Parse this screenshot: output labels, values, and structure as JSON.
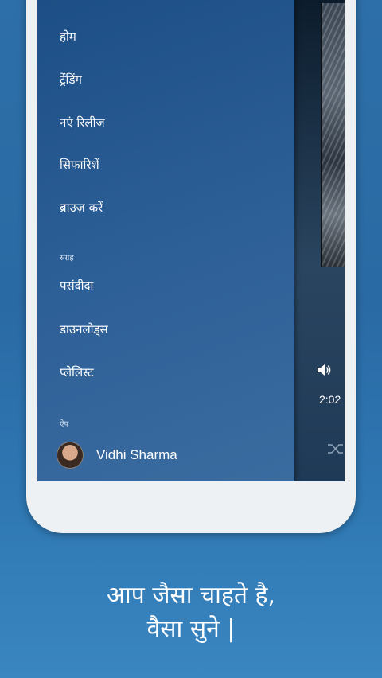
{
  "drawer": {
    "items": [
      {
        "label": "होम"
      },
      {
        "label": "ट्रेंडिंग"
      },
      {
        "label": "नएं रिलीज"
      },
      {
        "label": "सिफारिशें"
      },
      {
        "label": "ब्राउज़ करें"
      }
    ],
    "collection_label": "संग्रह",
    "collection_items": [
      {
        "label": "पसंदीदा"
      },
      {
        "label": "डाउनलोड्स"
      },
      {
        "label": "प्लेलिस्ट"
      }
    ],
    "app_label": "ऐप",
    "user_name": "Vidhi Sharma"
  },
  "player": {
    "time": "2:02",
    "icons": [
      "volume-icon",
      "shuffle-icon"
    ]
  },
  "tagline": {
    "line1": "आप जैसा चाहते है,",
    "line2": "वैसा सुने |"
  },
  "colors": {
    "background": "#2d6fa8",
    "drawer": "#2a5c94",
    "phone_frame": "#eef1f3"
  }
}
